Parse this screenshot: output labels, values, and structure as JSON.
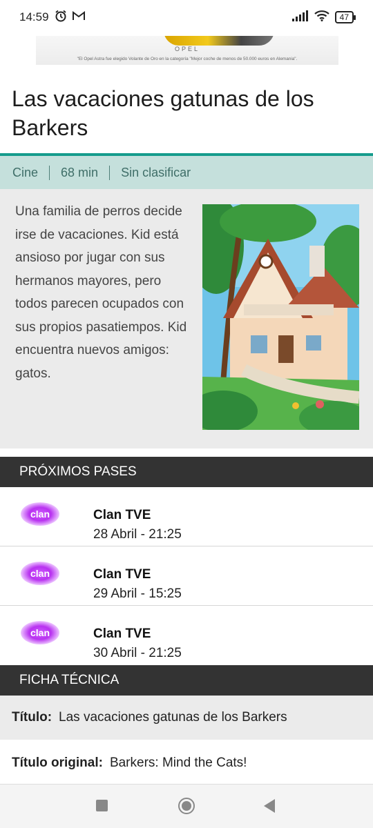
{
  "status": {
    "time": "14:59",
    "battery": "47"
  },
  "ad": {
    "brand": "OPEL",
    "caption": "\"El Opel Astra fue elegido Volante de Oro en la categoría \"Mejor coche de menos de 50.000 euros en Alemania\"."
  },
  "title": "Las vacaciones gatunas de los Barkers",
  "meta": {
    "genre": "Cine",
    "duration": "68 min",
    "rating": "Sin clasificar"
  },
  "synopsis": "Una familia de perros decide irse de vacaciones. Kid está ansioso por jugar con sus hermanos mayores, pero todos parecen ocupados con sus propios pasatiempos. Kid encuentra nuevos amigos: gatos.",
  "upcoming": {
    "header": "PRÓXIMOS PASES",
    "items": [
      {
        "logo": "clan",
        "channel": "Clan TVE",
        "when": "28 Abril - 21:25"
      },
      {
        "logo": "clan",
        "channel": "Clan TVE",
        "when": "29 Abril - 15:25"
      },
      {
        "logo": "clan",
        "channel": "Clan TVE",
        "when": "30 Abril - 21:25"
      }
    ]
  },
  "specs": {
    "header": "FICHA TÉCNICA",
    "rows": [
      {
        "label": "Título:",
        "value": "Las vacaciones gatunas de los Barkers"
      },
      {
        "label": "Título original:",
        "value": "Barkers: Mind the Cats!"
      }
    ]
  },
  "colors": {
    "accent": "#159b8c",
    "meta_bg": "#c5e0dc",
    "section_bg": "#333333",
    "channel_logo": "#b832f0"
  },
  "icons": [
    "alarm-icon",
    "gmail-icon",
    "signal-icon",
    "wifi-icon",
    "battery-icon",
    "recents-icon",
    "home-icon",
    "back-icon"
  ]
}
